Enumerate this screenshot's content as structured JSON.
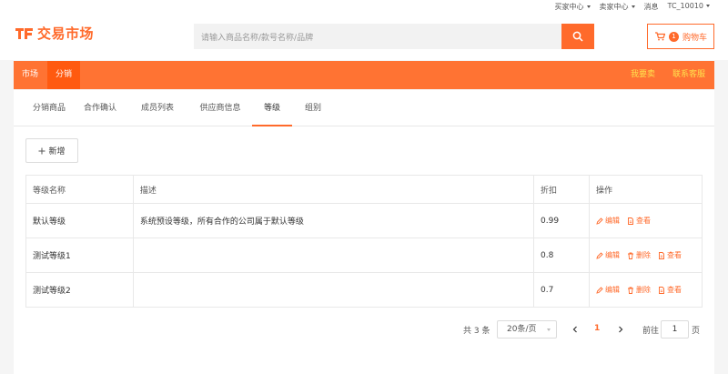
{
  "topbar": {
    "buyer_center": "买家中心",
    "seller_center": "卖家中心",
    "messages": "消息",
    "user": "TC_10010"
  },
  "header": {
    "logo_text": "交易市场",
    "search_placeholder": "请输入商品名称/款号名称/品牌",
    "cart_count": "1",
    "cart_label": "购物车"
  },
  "nav": {
    "items": [
      "市场",
      "分销"
    ],
    "active_index": 1,
    "right_links": [
      "我要卖",
      "联系客服"
    ]
  },
  "tabs": [
    "分销商品",
    "合作确认",
    "成员列表",
    "供应商信息",
    "等级",
    "组别"
  ],
  "active_tab": 4,
  "add_button_label": "新增",
  "table": {
    "headers": [
      "等级名称",
      "描述",
      "折扣",
      "操作"
    ],
    "rows": [
      {
        "name": "默认等级",
        "desc": "系统预设等级，所有合作的公司属于默认等级",
        "discount": "0.99",
        "ops": [
          "编辑",
          "查看"
        ]
      },
      {
        "name": "测试等级1",
        "desc": "",
        "discount": "0.8",
        "ops": [
          "编辑",
          "删除",
          "查看"
        ]
      },
      {
        "name": "测试等级2",
        "desc": "",
        "discount": "0.7",
        "ops": [
          "编辑",
          "删除",
          "查看"
        ]
      }
    ]
  },
  "pagination": {
    "total": "共 3 条",
    "page_size": "20条/页",
    "current_page": "1",
    "goto_label": "前往",
    "goto_value": "1",
    "page_suffix": "页"
  },
  "colors": {
    "accent": "#ff6a2b",
    "nav_bg": "#ff7333",
    "nav_right": "#ffe14d"
  }
}
